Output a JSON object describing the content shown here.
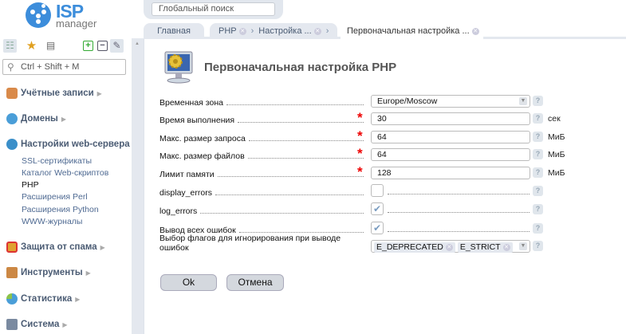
{
  "header": {
    "search_placeholder": "Глобальный поиск",
    "logo_text_1": "ISP",
    "logo_text_2": "manager"
  },
  "sidebar": {
    "search_placeholder": "Ctrl + Shift + M",
    "sections": [
      {
        "label": "Учётные записи",
        "icon": "users-icon"
      },
      {
        "label": "Домены",
        "icon": "globe-icon"
      },
      {
        "label": "Настройки web-сервера",
        "icon": "web-settings-icon",
        "items": [
          "SSL-сертификаты",
          "Каталог Web-скриптов",
          "PHP",
          "Расширения Perl",
          "Расширения Python",
          "WWW-журналы"
        ],
        "active": "PHP"
      },
      {
        "label": "Защита от спама",
        "icon": "shield-icon"
      },
      {
        "label": "Инструменты",
        "icon": "tools-icon"
      },
      {
        "label": "Статистика",
        "icon": "pie-chart-icon"
      },
      {
        "label": "Система",
        "icon": "calculator-icon"
      }
    ]
  },
  "tabs": [
    {
      "label": "Главная"
    },
    {
      "label": "PHP"
    },
    {
      "label": "Настройка ..."
    },
    {
      "label": "Первоначальная настройка ...",
      "active": true
    }
  ],
  "form": {
    "title": "Первоначальная настройка PHP",
    "fields": [
      {
        "label": "Временная зона",
        "value": "Europe/Moscow"
      },
      {
        "label": "Время выполнения",
        "value": "30",
        "unit": "сек",
        "required": true
      },
      {
        "label": "Макс. размер запроса",
        "value": "64",
        "unit": "МиБ",
        "required": true
      },
      {
        "label": "Макс. размер файлов",
        "value": "64",
        "unit": "МиБ",
        "required": true
      },
      {
        "label": "Лимит памяти",
        "value": "128",
        "unit": "МиБ",
        "required": true
      },
      {
        "label": "display_errors",
        "checked": false
      },
      {
        "label": "log_errors",
        "checked": true
      },
      {
        "label": "Вывод всех ошибок",
        "checked": true
      },
      {
        "label": "Выбор флагов для игнорирования при выводе ошибок",
        "values": [
          "E_DEPRECATED",
          "E_STRICT"
        ]
      }
    ],
    "ok_label": "Ok",
    "cancel_label": "Отмена",
    "help": "?",
    "required_mark": "*"
  }
}
